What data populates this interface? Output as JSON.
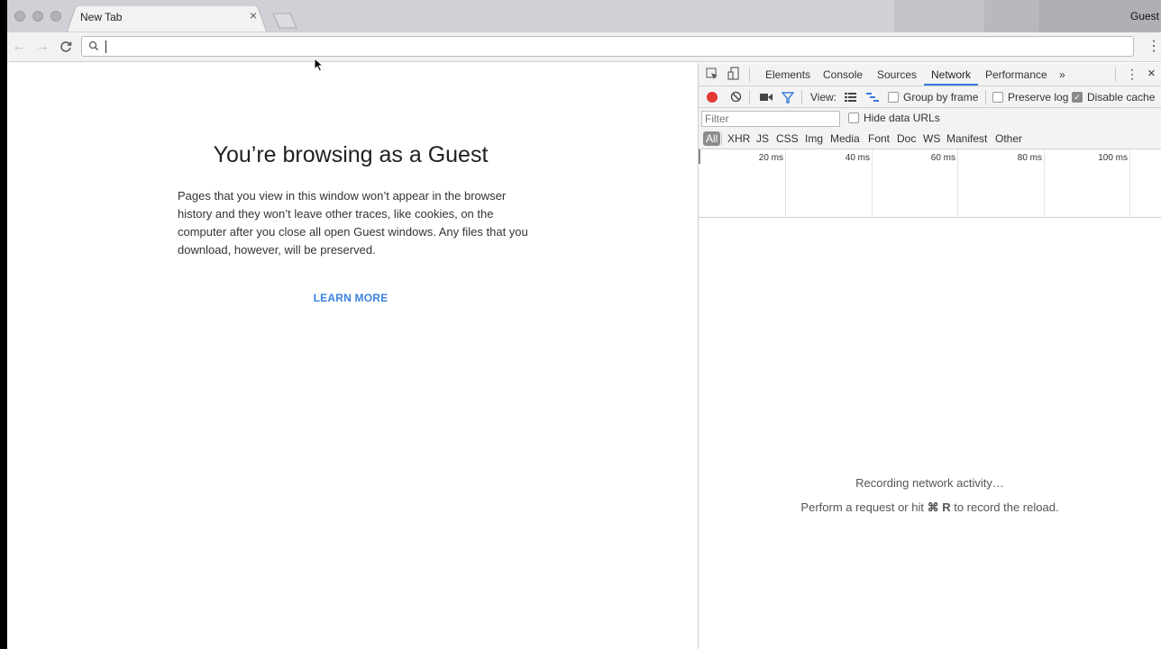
{
  "browser": {
    "tab": {
      "title": "New Tab",
      "close": "×"
    },
    "profile": "Guest",
    "nav": {
      "back": "←",
      "forward": "→",
      "reload": "C"
    },
    "omnibox": {
      "value": ""
    },
    "menu": "⋮"
  },
  "page": {
    "title": "You’re browsing as a Guest",
    "body": "Pages that you view in this window won’t appear in the browser history and they won’t leave other traces, like cookies, on the computer after you close all open Guest windows. Any files that you download, however, will be preserved.",
    "learn_more": "LEARN MORE"
  },
  "devtools": {
    "tabs": [
      "Elements",
      "Console",
      "Sources",
      "Network",
      "Performance"
    ],
    "active_tab": "Network",
    "more_tabs": "»",
    "menu": "⋮",
    "close": "×",
    "toolbar": {
      "view_label": "View:",
      "group_by_frame": "Group by frame",
      "preserve_log": "Preserve log",
      "disable_cache": "Disable cache",
      "disable_cache_checked": true
    },
    "filter": {
      "placeholder": "Filter",
      "hide_data_urls": "Hide data URLs",
      "types": [
        "All",
        "XHR",
        "JS",
        "CSS",
        "Img",
        "Media",
        "Font",
        "Doc",
        "WS",
        "Manifest",
        "Other"
      ],
      "active_type": "All"
    },
    "timeline": {
      "ticks": [
        "20 ms",
        "40 ms",
        "60 ms",
        "80 ms",
        "100 ms"
      ]
    },
    "empty": {
      "line1": "Recording network activity…",
      "line2_pre": "Perform a request or hit ",
      "line2_key": "⌘ R",
      "line2_post": " to record the reload."
    },
    "colors": {
      "record": "#e53935",
      "accent": "#3879d9"
    }
  }
}
